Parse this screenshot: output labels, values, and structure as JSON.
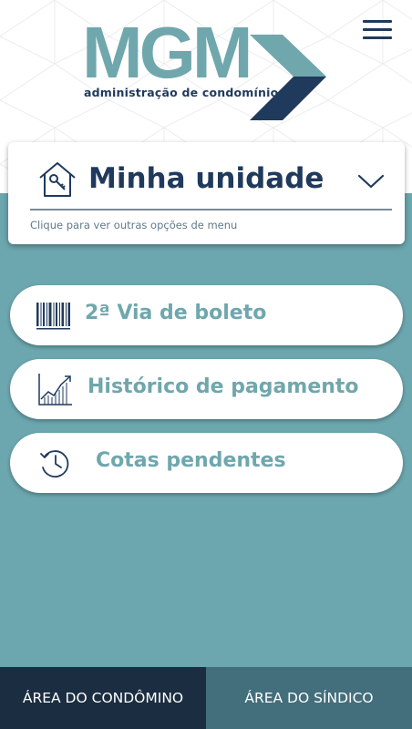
{
  "brand": {
    "logo_text": "MGM",
    "tagline": "administração de condomínios"
  },
  "colors": {
    "teal": "#6ca6ae",
    "navy": "#1f3a5c",
    "tab_active": "#1b2d40",
    "tab_inactive": "#436e7c"
  },
  "header": {
    "menu_icon": "hamburger-menu-icon"
  },
  "unit_selector": {
    "icon": "house-key-icon",
    "title": "Minha unidade",
    "hint": "Clique para ver outras opções de menu",
    "chevron_icon": "chevron-down-icon"
  },
  "menu": {
    "items": [
      {
        "label": "2ª Via de boleto",
        "icon": "barcode-icon"
      },
      {
        "label": "Histórico de pagamento",
        "icon": "growth-chart-icon"
      },
      {
        "label": "Cotas pendentes",
        "icon": "clock-history-icon"
      }
    ]
  },
  "tabs": {
    "condomino": "ÁREA DO CONDÔMINO",
    "sindico": "ÁREA DO SÍNDICO"
  }
}
